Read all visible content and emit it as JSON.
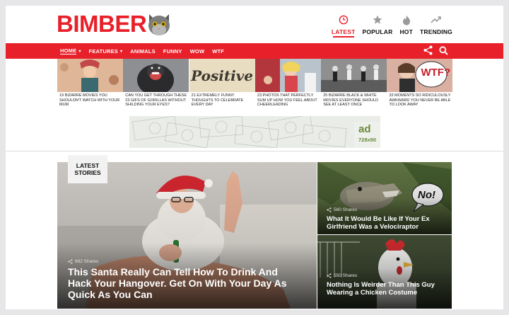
{
  "brand": {
    "name": "BIMBER",
    "accent": "#e8202a"
  },
  "topnav": [
    {
      "label": "LATEST",
      "icon": "clock-icon",
      "active": true
    },
    {
      "label": "POPULAR",
      "icon": "star-icon",
      "active": false
    },
    {
      "label": "HOT",
      "icon": "flame-icon",
      "active": false
    },
    {
      "label": "TRENDING",
      "icon": "trending-icon",
      "active": false
    }
  ],
  "menu": {
    "home": "HOME",
    "features": "FEATURES",
    "animals": "ANIMALS",
    "funny": "FUNNY",
    "wow": "WOW",
    "wtf": "WTF"
  },
  "strip": [
    {
      "caption": "19 BIZARRE MOVIES YOU SHOULDN'T WATCH WITH YOUR MUM"
    },
    {
      "caption": "CAN YOU GET THROUGH THESE 23 GIFS OF GORILLAS WITHOUT SHILDING YOUR EYES?"
    },
    {
      "caption": "21 EXTREMELY FUNNY THOUGHTS TO CELEBRATE EVERY DAY",
      "thumb_text": "Positive"
    },
    {
      "caption": "23 PHOTOS THAT PERFECTLY SUM UP HOW YOU FEEL ABOUT CHEERLEADING"
    },
    {
      "caption": "25 BIZARRE BLACK & WHITE MOVIES EVERYONE SHOULD SEE AT LEAST ONCE"
    },
    {
      "caption": "33 MOMENTS SO RIDICULOUSLY AWKWARD YOU NEVER BE ABLE TO LOOK AWAY",
      "thumb_text": "WTF?"
    }
  ],
  "ad": {
    "label": "ad",
    "size": "728x90"
  },
  "latest_badge": {
    "line1": "LATEST",
    "line2": "STORIES"
  },
  "hero": {
    "shares": "662 Shares",
    "title": "This Santa Really Can Tell How To Drink And Hack Your Hangover. Get On With Your Day As Quick As You Can"
  },
  "side": [
    {
      "shares": "560 Shares",
      "title": "What It Would Be Like If Your Ex Girlfriend Was a Velociraptor",
      "bubble": "No!"
    },
    {
      "shares": "550 Shares",
      "title": "Nothing Is Weirder Than This Guy Wearing a Chicken Costume"
    }
  ]
}
